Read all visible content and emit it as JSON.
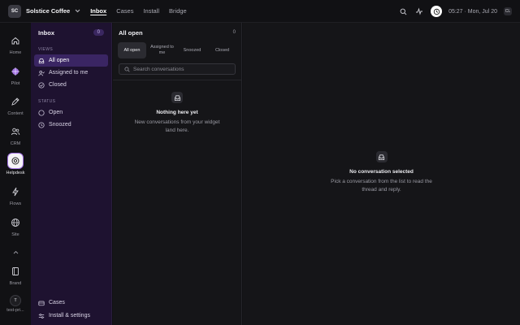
{
  "workspace": {
    "initials": "SC",
    "name": "Solstice Coffee"
  },
  "top_tabs": [
    {
      "label": "Inbox",
      "active": true
    },
    {
      "label": "Cases",
      "active": false
    },
    {
      "label": "Install",
      "active": false
    },
    {
      "label": "Bridge",
      "active": false
    }
  ],
  "topbar_right": {
    "clock": "05:27 · Mon, Jul 20",
    "kbd": "CL",
    "icons": [
      "search-icon",
      "pulse-icon",
      "timer-icon"
    ]
  },
  "rail": {
    "items": [
      {
        "label": "Home",
        "icon": "home-icon"
      },
      {
        "label": "Pilot",
        "icon": "pilot-icon"
      },
      {
        "label": "Content",
        "icon": "pen-icon"
      },
      {
        "label": "CRM",
        "icon": "users-icon"
      },
      {
        "label": "Helpdesk",
        "icon": "helpdesk-icon",
        "active": true
      },
      {
        "label": "Flows",
        "icon": "bolt-icon"
      },
      {
        "label": "Site",
        "icon": "globe-icon"
      },
      {
        "label": "Brand",
        "icon": "book-icon"
      }
    ],
    "user": {
      "initial": "T",
      "label": "test-pri..."
    }
  },
  "sidebar": {
    "title": "Inbox",
    "count": "0",
    "views_heading": "VIEWS",
    "views": [
      {
        "label": "All open",
        "icon": "inbox-icon",
        "active": true
      },
      {
        "label": "Assigned to me",
        "icon": "user-check-icon"
      },
      {
        "label": "Closed",
        "icon": "check-circle-icon"
      }
    ],
    "status_heading": "STATUS",
    "statuses": [
      {
        "label": "Open",
        "icon": "circle-icon"
      },
      {
        "label": "Snoozed",
        "icon": "clock-icon"
      }
    ],
    "bottom": [
      {
        "label": "Cases",
        "icon": "cases-icon"
      },
      {
        "label": "Install & settings",
        "icon": "sliders-icon"
      }
    ]
  },
  "list": {
    "title": "All open",
    "count": "0",
    "filters": [
      {
        "label": "All open",
        "active": true
      },
      {
        "label": "Assigned to me"
      },
      {
        "label": "Snoozed"
      },
      {
        "label": "Closed"
      }
    ],
    "search_placeholder": "Search conversations",
    "empty_title": "Nothing here yet",
    "empty_sub": "New conversations from your widget land here."
  },
  "detail": {
    "title": "No conversation selected",
    "sub": "Pick a conversation from the list to read the thread and reply."
  },
  "colors": {
    "accent": "#a070e0",
    "sidebar_bg": "#1e1230",
    "active_item": "#3a2563"
  }
}
